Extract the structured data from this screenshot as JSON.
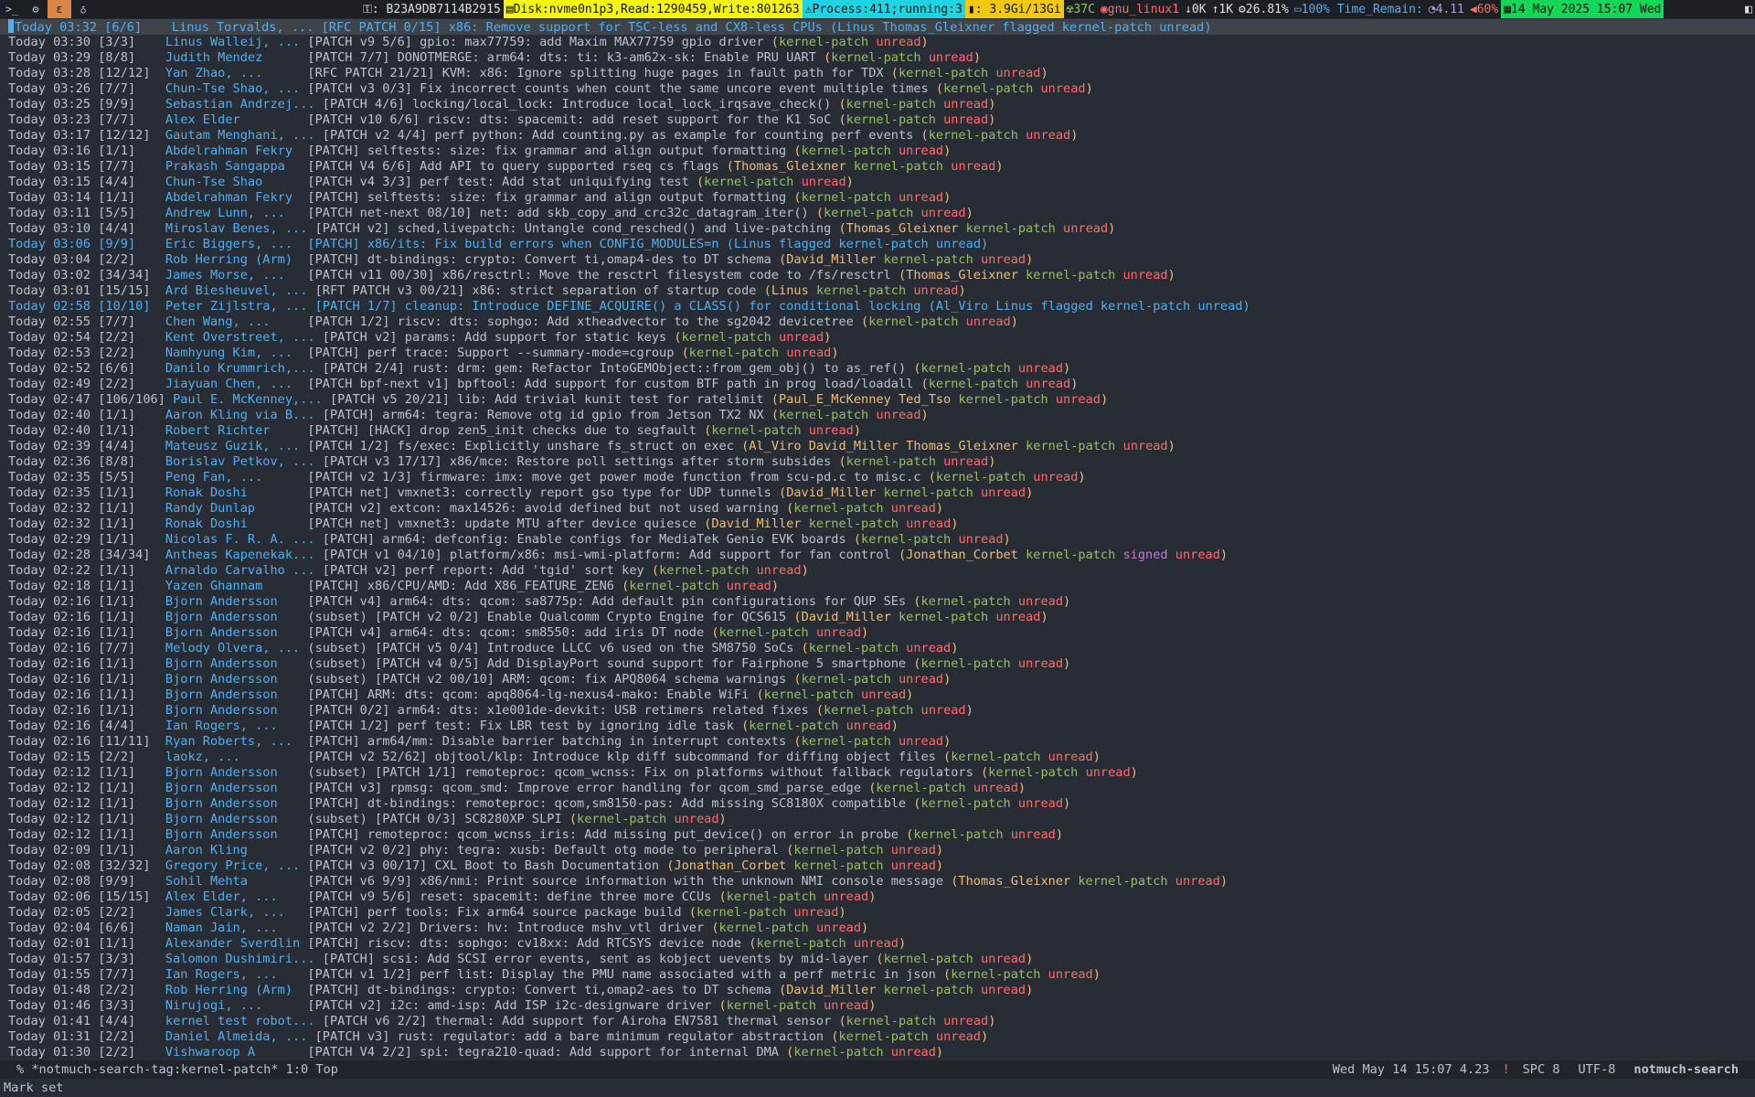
{
  "topbar": {
    "network_label": ": B23A9DB7114B2915",
    "disk_label": "Disk:nvme0n1p3,Read:1290459,Write:801263",
    "process_label": " Process:411;running:3",
    "memory_label": ": 3.9Gi/13Gi",
    "temp_label": "37C",
    "wifi_label": "gnu_linux1",
    "net_down_label": "0K",
    "net_up_label": "1K",
    "cpu_label": "26.81%",
    "battery_label": "100% Time_Remain:",
    "load_label": "4.11",
    "volume_label": "60%",
    "date_label": "14 May 2025 15:07 Wed",
    "colors": {
      "disk": "#f6f60a",
      "process": "#1fd4e2",
      "memory": "#f2c90c",
      "date": "#14d659"
    }
  },
  "rows": [
    {
      "date": "Today 03:32",
      "count": "[6/6]",
      "author": "Linus Torvalds, ...",
      "subject": "[RFC PATCH 0/15] x86: Remove support for TSC-less and CX8-less CPUs",
      "tags": [
        "Linus",
        "Thomas_Gleixner",
        "flagged",
        "kernel-patch",
        "unread"
      ],
      "flagged": true
    },
    {
      "date": "Today 03:30",
      "count": "[3/3]",
      "author": "Linus Walleij, ...",
      "subject": "[PATCH v9 5/6] gpio: max77759: add Maxim MAX77759 gpio driver",
      "tags": [
        "kernel-patch",
        "unread"
      ]
    },
    {
      "date": "Today 03:29",
      "count": "[8/8]",
      "author": "Judith Mendez",
      "subject": "[PATCH 7/7] DONOTMERGE: arm64: dts: ti: k3-am62x-sk: Enable PRU UART",
      "tags": [
        "kernel-patch",
        "unread"
      ]
    },
    {
      "date": "Today 03:28",
      "count": "[12/12]",
      "author": "Yan Zhao, ...",
      "subject": "[RFC PATCH 21/21] KVM: x86: Ignore splitting huge pages in fault path for TDX",
      "tags": [
        "kernel-patch",
        "unread"
      ]
    },
    {
      "date": "Today 03:26",
      "count": "[7/7]",
      "author": "Chun-Tse Shao, ...",
      "subject": "[PATCH v3 0/3] Fix incorrect counts when count the same uncore event multiple times",
      "tags": [
        "kernel-patch",
        "unread"
      ]
    },
    {
      "date": "Today 03:25",
      "count": "[9/9]",
      "author": "Sebastian Andrzej...",
      "subject": "[PATCH 4/6] locking/local_lock: Introduce local_lock_irqsave_check()",
      "tags": [
        "kernel-patch",
        "unread"
      ]
    },
    {
      "date": "Today 03:23",
      "count": "[7/7]",
      "author": "Alex Elder",
      "subject": "[PATCH v10 6/6] riscv: dts: spacemit: add reset support for the K1 SoC",
      "tags": [
        "kernel-patch",
        "unread"
      ]
    },
    {
      "date": "Today 03:17",
      "count": "[12/12]",
      "author": "Gautam Menghani, ...",
      "subject": "[PATCH v2 4/4] perf python: Add counting.py as example for counting perf events",
      "tags": [
        "kernel-patch",
        "unread"
      ]
    },
    {
      "date": "Today 03:16",
      "count": "[1/1]",
      "author": "Abdelrahman Fekry",
      "subject": "[PATCH] selftests: size: fix grammar and align output formatting",
      "tags": [
        "kernel-patch",
        "unread"
      ]
    },
    {
      "date": "Today 03:15",
      "count": "[7/7]",
      "author": "Prakash Sangappa",
      "subject": "[PATCH V4 6/6] Add API to query supported rseq cs flags",
      "tags": [
        "Thomas_Gleixner",
        "kernel-patch",
        "unread"
      ]
    },
    {
      "date": "Today 03:15",
      "count": "[4/4]",
      "author": "Chun-Tse Shao",
      "subject": "[PATCH v4 3/3] perf test: Add stat uniquifying test",
      "tags": [
        "kernel-patch",
        "unread"
      ]
    },
    {
      "date": "Today 03:14",
      "count": "[1/1]",
      "author": "Abdelrahman Fekry",
      "subject": "[PATCH] selftests: size: fix grammar and align output formatting",
      "tags": [
        "kernel-patch",
        "unread"
      ]
    },
    {
      "date": "Today 03:11",
      "count": "[5/5]",
      "author": "Andrew Lunn, ...",
      "subject": "[PATCH net-next 08/10] net: add skb_copy_and_crc32c_datagram_iter()",
      "tags": [
        "kernel-patch",
        "unread"
      ]
    },
    {
      "date": "Today 03:10",
      "count": "[4/4]",
      "author": "Miroslav Benes, ...",
      "subject": "[PATCH v2] sched,livepatch: Untangle cond_resched() and live-patching",
      "tags": [
        "Thomas_Gleixner",
        "kernel-patch",
        "unread"
      ]
    },
    {
      "date": "Today 03:06",
      "count": "[9/9]",
      "author": "Eric Biggers, ...",
      "subject": "[PATCH] x86/its: Fix build errors when CONFIG_MODULES=n",
      "tags": [
        "Linus",
        "flagged",
        "kernel-patch",
        "unread"
      ],
      "flagged": true
    },
    {
      "date": "Today 03:04",
      "count": "[2/2]",
      "author": "Rob Herring (Arm)",
      "subject": "[PATCH] dt-bindings: crypto: Convert ti,omap4-des to DT schema",
      "tags": [
        "David_Miller",
        "kernel-patch",
        "unread"
      ]
    },
    {
      "date": "Today 03:02",
      "count": "[34/34]",
      "author": "James Morse, ...",
      "subject": "[PATCH v11 00/30] x86/resctrl: Move the resctrl filesystem code to /fs/resctrl",
      "tags": [
        "Thomas_Gleixner",
        "kernel-patch",
        "unread"
      ]
    },
    {
      "date": "Today 03:01",
      "count": "[15/15]",
      "author": "Ard Biesheuvel, ...",
      "subject": "[RFT PATCH v3 00/21] x86: strict separation of startup code",
      "tags": [
        "Linus",
        "kernel-patch",
        "unread"
      ]
    },
    {
      "date": "Today 02:58",
      "count": "[10/10]",
      "author": "Peter Zijlstra, ...",
      "subject": "[PATCH 1/7] cleanup: Introduce DEFINE_ACQUIRE() a CLASS() for conditional locking",
      "tags": [
        "Al_Viro",
        "Linus",
        "flagged",
        "kernel-patch",
        "unread"
      ],
      "flagged": true
    },
    {
      "date": "Today 02:55",
      "count": "[7/7]",
      "author": "Chen Wang, ...",
      "subject": "[PATCH 1/2] riscv: dts: sophgo: Add xtheadvector to the sg2042 devicetree",
      "tags": [
        "kernel-patch",
        "unread"
      ]
    },
    {
      "date": "Today 02:54",
      "count": "[2/2]",
      "author": "Kent Overstreet, ...",
      "subject": "[PATCH v2] params: Add support for static keys",
      "tags": [
        "kernel-patch",
        "unread"
      ]
    },
    {
      "date": "Today 02:53",
      "count": "[2/2]",
      "author": "Namhyung Kim, ...",
      "subject": "[PATCH] perf trace: Support --summary-mode=cgroup",
      "tags": [
        "kernel-patch",
        "unread"
      ]
    },
    {
      "date": "Today 02:52",
      "count": "[6/6]",
      "author": "Danilo Krummrich,...",
      "subject": "[PATCH 2/4] rust: drm: gem: Refactor IntoGEMObject::from_gem_obj() to as_ref()",
      "tags": [
        "kernel-patch",
        "unread"
      ]
    },
    {
      "date": "Today 02:49",
      "count": "[2/2]",
      "author": "Jiayuan Chen, ...",
      "subject": "[PATCH bpf-next v1] bpftool: Add support for custom BTF path in prog load/loadall",
      "tags": [
        "kernel-patch",
        "unread"
      ]
    },
    {
      "date": "Today 02:47",
      "count": "[106/106]",
      "author": "Paul E. McKenney,...",
      "subject": "[PATCH v5 20/21] lib: Add trivial kunit test for ratelimit",
      "tags": [
        "Paul_E_McKenney",
        "Ted_Tso",
        "kernel-patch",
        "unread"
      ]
    },
    {
      "date": "Today 02:40",
      "count": "[1/1]",
      "author": "Aaron Kling via B...",
      "subject": "[PATCH] arm64: tegra: Remove otg id gpio from Jetson TX2 NX",
      "tags": [
        "kernel-patch",
        "unread"
      ]
    },
    {
      "date": "Today 02:40",
      "count": "[1/1]",
      "author": "Robert Richter",
      "subject": "[PATCH] [HACK] drop zen5_init checks due to segfault",
      "tags": [
        "kernel-patch",
        "unread"
      ]
    },
    {
      "date": "Today 02:39",
      "count": "[4/4]",
      "author": "Mateusz Guzik, ...",
      "subject": "[PATCH 1/2] fs/exec: Explicitly unshare fs_struct on exec",
      "tags": [
        "Al_Viro",
        "David_Miller",
        "Thomas_Gleixner",
        "kernel-patch",
        "unread"
      ]
    },
    {
      "date": "Today 02:36",
      "count": "[8/8]",
      "author": "Borislav Petkov, ...",
      "subject": "[PATCH v3 17/17] x86/mce: Restore poll settings after storm subsides",
      "tags": [
        "kernel-patch",
        "unread"
      ]
    },
    {
      "date": "Today 02:35",
      "count": "[5/5]",
      "author": "Peng Fan, ...",
      "subject": "[PATCH v2 1/3] firmware: imx: move get power mode function from scu-pd.c to misc.c",
      "tags": [
        "kernel-patch",
        "unread"
      ]
    },
    {
      "date": "Today 02:35",
      "count": "[1/1]",
      "author": "Ronak Doshi",
      "subject": "[PATCH net] vmxnet3: correctly report gso type for UDP tunnels",
      "tags": [
        "David_Miller",
        "kernel-patch",
        "unread"
      ]
    },
    {
      "date": "Today 02:32",
      "count": "[1/1]",
      "author": "Randy Dunlap",
      "subject": "[PATCH v2] extcon: max14526: avoid defined but not used warning",
      "tags": [
        "kernel-patch",
        "unread"
      ]
    },
    {
      "date": "Today 02:32",
      "count": "[1/1]",
      "author": "Ronak Doshi",
      "subject": "[PATCH net] vmxnet3: update MTU after device quiesce",
      "tags": [
        "David_Miller",
        "kernel-patch",
        "unread"
      ]
    },
    {
      "date": "Today 02:29",
      "count": "[1/1]",
      "author": "Nicolas F. R. A. ...",
      "subject": "[PATCH] arm64: defconfig: Enable configs for MediaTek Genio EVK boards",
      "tags": [
        "kernel-patch",
        "unread"
      ]
    },
    {
      "date": "Today 02:28",
      "count": "[34/34]",
      "author": "Antheas Kapenekak...",
      "subject": "[PATCH v1 04/10] platform/x86: msi-wmi-platform: Add support for fan control",
      "tags": [
        "Jonathan_Corbet",
        "kernel-patch",
        "signed",
        "unread"
      ]
    },
    {
      "date": "Today 02:22",
      "count": "[1/1]",
      "author": "Arnaldo Carvalho ...",
      "subject": "[PATCH v2] perf report: Add 'tgid' sort key",
      "tags": [
        "kernel-patch",
        "unread"
      ]
    },
    {
      "date": "Today 02:18",
      "count": "[1/1]",
      "author": "Yazen Ghannam",
      "subject": "[PATCH] x86/CPU/AMD: Add X86_FEATURE_ZEN6",
      "tags": [
        "kernel-patch",
        "unread"
      ]
    },
    {
      "date": "Today 02:16",
      "count": "[1/1]",
      "author": "Bjorn Andersson",
      "subject": "[PATCH v4] arm64: dts: qcom: sa8775p: Add default pin configurations for QUP SEs",
      "tags": [
        "kernel-patch",
        "unread"
      ]
    },
    {
      "date": "Today 02:16",
      "count": "[1/1]",
      "author": "Bjorn Andersson",
      "subject": "(subset) [PATCH v2 0/2] Enable Qualcomm Crypto Engine for QCS615",
      "tags": [
        "David_Miller",
        "kernel-patch",
        "unread"
      ]
    },
    {
      "date": "Today 02:16",
      "count": "[1/1]",
      "author": "Bjorn Andersson",
      "subject": "[PATCH v4] arm64: dts: qcom: sm8550: add iris DT node",
      "tags": [
        "kernel-patch",
        "unread"
      ]
    },
    {
      "date": "Today 02:16",
      "count": "[7/7]",
      "author": "Melody Olvera, ...",
      "subject": "(subset) [PATCH v5 0/4] Introduce LLCC v6 used on the SM8750 SoCs",
      "tags": [
        "kernel-patch",
        "unread"
      ]
    },
    {
      "date": "Today 02:16",
      "count": "[1/1]",
      "author": "Bjorn Andersson",
      "subject": "(subset) [PATCH v4 0/5] Add DisplayPort sound support for Fairphone 5 smartphone",
      "tags": [
        "kernel-patch",
        "unread"
      ]
    },
    {
      "date": "Today 02:16",
      "count": "[1/1]",
      "author": "Bjorn Andersson",
      "subject": "(subset) [PATCH v2 00/10] ARM: qcom: fix APQ8064 schema warnings",
      "tags": [
        "kernel-patch",
        "unread"
      ]
    },
    {
      "date": "Today 02:16",
      "count": "[1/1]",
      "author": "Bjorn Andersson",
      "subject": "[PATCH] ARM: dts: qcom: apq8064-lg-nexus4-mako: Enable WiFi",
      "tags": [
        "kernel-patch",
        "unread"
      ]
    },
    {
      "date": "Today 02:16",
      "count": "[1/1]",
      "author": "Bjorn Andersson",
      "subject": "[PATCH 0/2] arm64: dts: x1e001de-devkit: USB retimers related fixes",
      "tags": [
        "kernel-patch",
        "unread"
      ]
    },
    {
      "date": "Today 02:16",
      "count": "[4/4]",
      "author": "Ian Rogers, ...",
      "subject": "[PATCH 1/2] perf test: Fix LBR test by ignoring idle task",
      "tags": [
        "kernel-patch",
        "unread"
      ]
    },
    {
      "date": "Today 02:16",
      "count": "[11/11]",
      "author": "Ryan Roberts, ...",
      "subject": "[PATCH] arm64/mm: Disable barrier batching in interrupt contexts",
      "tags": [
        "kernel-patch",
        "unread"
      ]
    },
    {
      "date": "Today 02:15",
      "count": "[2/2]",
      "author": "laokz, ...",
      "subject": "[PATCH v2 52/62] objtool/klp: Introduce klp diff subcommand for diffing object files",
      "tags": [
        "kernel-patch",
        "unread"
      ]
    },
    {
      "date": "Today 02:12",
      "count": "[1/1]",
      "author": "Bjorn Andersson",
      "subject": "(subset) [PATCH 1/1] remoteproc: qcom_wcnss: Fix on platforms without fallback regulators",
      "tags": [
        "kernel-patch",
        "unread"
      ]
    },
    {
      "date": "Today 02:12",
      "count": "[1/1]",
      "author": "Bjorn Andersson",
      "subject": "[PATCH v3] rpmsg: qcom_smd: Improve error handling for qcom_smd_parse_edge",
      "tags": [
        "kernel-patch",
        "unread"
      ]
    },
    {
      "date": "Today 02:12",
      "count": "[1/1]",
      "author": "Bjorn Andersson",
      "subject": "[PATCH] dt-bindings: remoteproc: qcom,sm8150-pas: Add missing SC8180X compatible",
      "tags": [
        "kernel-patch",
        "unread"
      ]
    },
    {
      "date": "Today 02:12",
      "count": "[1/1]",
      "author": "Bjorn Andersson",
      "subject": "(subset) [PATCH 0/3] SC8280XP SLPI",
      "tags": [
        "kernel-patch",
        "unread"
      ]
    },
    {
      "date": "Today 02:12",
      "count": "[1/1]",
      "author": "Bjorn Andersson",
      "subject": "[PATCH] remoteproc: qcom_wcnss_iris: Add missing put_device() on error in probe",
      "tags": [
        "kernel-patch",
        "unread"
      ]
    },
    {
      "date": "Today 02:09",
      "count": "[1/1]",
      "author": "Aaron Kling",
      "subject": "[PATCH v2 0/2] phy: tegra: xusb: Default otg mode to peripheral",
      "tags": [
        "kernel-patch",
        "unread"
      ]
    },
    {
      "date": "Today 02:08",
      "count": "[32/32]",
      "author": "Gregory Price, ...",
      "subject": "[PATCH v3 00/17] CXL Boot to Bash Documentation",
      "tags": [
        "Jonathan_Corbet",
        "kernel-patch",
        "unread"
      ]
    },
    {
      "date": "Today 02:08",
      "count": "[9/9]",
      "author": "Sohil Mehta",
      "subject": "[PATCH v6 9/9] x86/nmi: Print source information with the unknown NMI console message",
      "tags": [
        "Thomas_Gleixner",
        "kernel-patch",
        "unread"
      ]
    },
    {
      "date": "Today 02:06",
      "count": "[15/15]",
      "author": "Alex Elder, ...",
      "subject": "[PATCH v9 5/6] reset: spacemit: define three more CCUs",
      "tags": [
        "kernel-patch",
        "unread"
      ]
    },
    {
      "date": "Today 02:05",
      "count": "[2/2]",
      "author": "James Clark, ...",
      "subject": "[PATCH] perf tools: Fix arm64 source package build",
      "tags": [
        "kernel-patch",
        "unread"
      ]
    },
    {
      "date": "Today 02:04",
      "count": "[6/6]",
      "author": "Naman Jain, ...",
      "subject": "[PATCH v2 2/2] Drivers: hv: Introduce mshv_vtl driver",
      "tags": [
        "kernel-patch",
        "unread"
      ]
    },
    {
      "date": "Today 02:01",
      "count": "[1/1]",
      "author": "Alexander Sverdlin",
      "subject": "[PATCH] riscv: dts: sophgo: cv18xx: Add RTCSYS device node",
      "tags": [
        "kernel-patch",
        "unread"
      ]
    },
    {
      "date": "Today 01:57",
      "count": "[3/3]",
      "author": "Salomon Dushimiri...",
      "subject": "[PATCH] scsi: Add SCSI error events, sent as kobject uevents by mid-layer",
      "tags": [
        "kernel-patch",
        "unread"
      ]
    },
    {
      "date": "Today 01:55",
      "count": "[7/7]",
      "author": "Ian Rogers, ...",
      "subject": "[PATCH v1 1/2] perf list: Display the PMU name associated with a perf metric in json",
      "tags": [
        "kernel-patch",
        "unread"
      ]
    },
    {
      "date": "Today 01:48",
      "count": "[2/2]",
      "author": "Rob Herring (Arm)",
      "subject": "[PATCH] dt-bindings: crypto: Convert ti,omap2-aes to DT schema",
      "tags": [
        "David_Miller",
        "kernel-patch",
        "unread"
      ]
    },
    {
      "date": "Today 01:46",
      "count": "[3/3]",
      "author": "Nirujogi, ...",
      "subject": "[PATCH v2] i2c: amd-isp: Add ISP i2c-designware driver",
      "tags": [
        "kernel-patch",
        "unread"
      ]
    },
    {
      "date": "Today 01:41",
      "count": "[4/4]",
      "author": "kernel test robot...",
      "subject": "[PATCH v6 2/2] thermal: Add support for Airoha EN7581 thermal sensor",
      "tags": [
        "kernel-patch",
        "unread"
      ]
    },
    {
      "date": "Today 01:31",
      "count": "[2/2]",
      "author": "Daniel Almeida, ...",
      "subject": "[PATCH v3] rust: regulator: add a bare minimum regulator abstraction",
      "tags": [
        "kernel-patch",
        "unread"
      ]
    },
    {
      "date": "Today 01:30",
      "count": "[2/2]",
      "author": "Vishwaroop A",
      "subject": "[PATCH V4 2/2] spi: tegra210-quad: Add support for internal DMA",
      "tags": [
        "kernel-patch",
        "unread"
      ]
    }
  ],
  "modeline": {
    "left": "% *notmuch-search-tag:kernel-patch*  1:0 Top",
    "time": "Wed May 14 15:07 4.23",
    "warn": "!",
    "spc": "SPC 8",
    "encoding": "UTF-8",
    "mode": "notmuch-search"
  },
  "minibuffer": "Mark set"
}
